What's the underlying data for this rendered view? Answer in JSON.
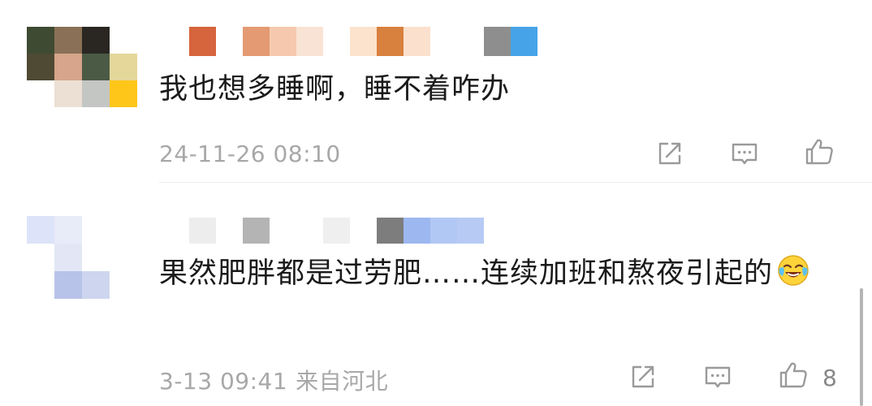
{
  "comments": [
    {
      "text": "我也想多睡啊，睡不着咋办",
      "timestamp": "24-11-26 08:10",
      "location": "",
      "like_count": "",
      "avatar_colors": [
        "#3f4a33",
        "#8a7056",
        "#2a2722",
        "#ffffff",
        "#4e4a34",
        "#d6a58b",
        "#4b5a45",
        "#e5d79a",
        "#ffffff",
        "#ece0d4",
        "#c4c6c3",
        "#ffc61a"
      ],
      "name_strip_colors": [
        "#ffffff",
        "#d6643c",
        "#ffffff",
        "#e49a72",
        "#f6c9ae",
        "#f9e3d4",
        "#ffffff",
        "#fbe3cd",
        "#d8803e",
        "#fbe1cd",
        "#ffffff",
        "#ffffff",
        "#8e8e8e",
        "#47a3e8"
      ],
      "actions": {
        "share_icon": "share-icon",
        "reply_icon": "comment-icon",
        "like_icon": "thumbs-up-icon"
      }
    },
    {
      "text": "果然肥胖都是过劳肥……连续加班和熬夜引起的",
      "emoji_icon": "laughing-crying-emoji",
      "timestamp": "3-13 09:41",
      "location": "来自河北",
      "like_count": "8",
      "avatar_colors": [
        "#dde3f8",
        "#e8ebf8",
        "#ffffff",
        "#ffffff",
        "#e3e7f5",
        "#ffffff",
        "#ffffff",
        "#b8c3ea",
        "#ced5ee"
      ],
      "name_strip_colors": [
        "#ffffff",
        "#ededed",
        "#ffffff",
        "#b4b4b4",
        "#ffffff",
        "#ffffff",
        "#efefef",
        "#ffffff",
        "#7d7d7d",
        "#9db8f0",
        "#b2c8f4",
        "#b6caf4"
      ],
      "actions": {
        "share_icon": "share-icon",
        "reply_icon": "comment-icon",
        "like_icon": "thumbs-up-icon"
      }
    }
  ]
}
